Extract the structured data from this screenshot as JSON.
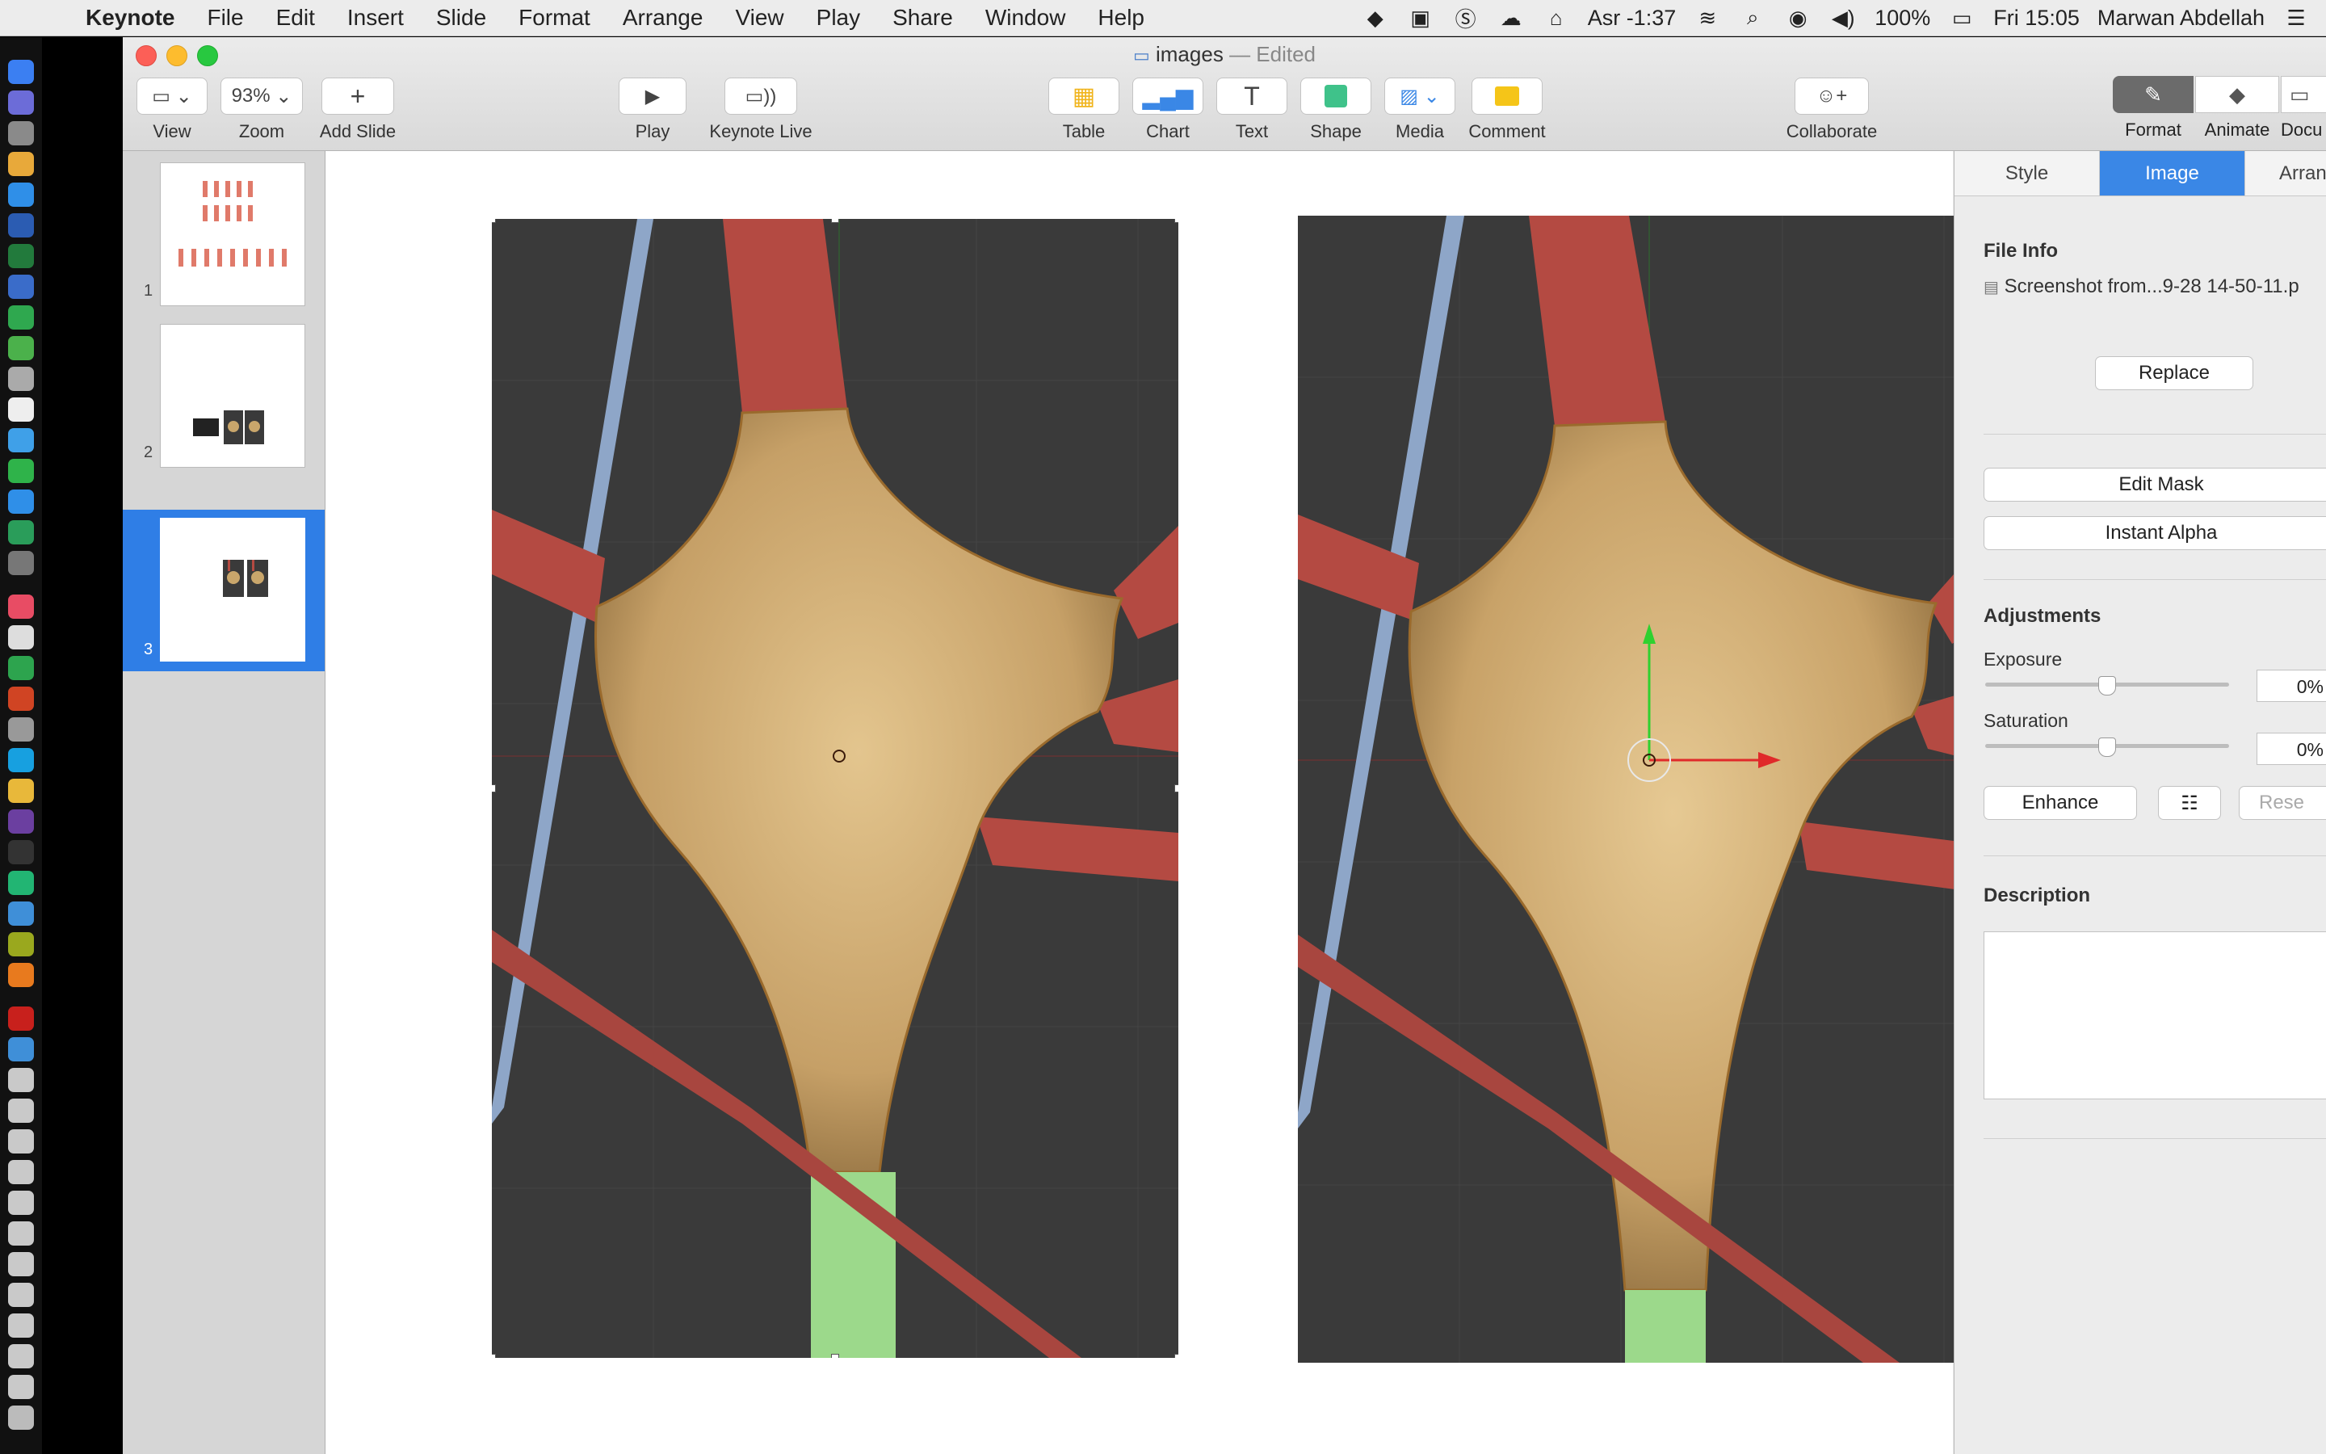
{
  "menubar": {
    "app_name": "Keynote",
    "items": [
      "File",
      "Edit",
      "Insert",
      "Slide",
      "Format",
      "Arrange",
      "View",
      "Play",
      "Share",
      "Window",
      "Help"
    ],
    "prayer_time": "Asr -1:37",
    "battery": "100%",
    "clock": "Fri 15:05",
    "user": "Marwan Abdellah"
  },
  "window": {
    "doc_title": "images",
    "doc_status": "— Edited"
  },
  "toolbar": {
    "view_label": "View",
    "zoom_value": "93%",
    "zoom_label": "Zoom",
    "add_slide_label": "Add Slide",
    "play_label": "Play",
    "keynote_live_label": "Keynote Live",
    "table_label": "Table",
    "chart_label": "Chart",
    "text_label": "Text",
    "shape_label": "Shape",
    "media_label": "Media",
    "comment_label": "Comment",
    "collaborate_label": "Collaborate",
    "format_label": "Format",
    "animate_label": "Animate",
    "document_label": "Docu"
  },
  "navigator": {
    "slides": [
      {
        "number": "1",
        "selected": false
      },
      {
        "number": "2",
        "selected": false
      },
      {
        "number": "3",
        "selected": true
      }
    ]
  },
  "inspector": {
    "tabs": [
      "Style",
      "Image",
      "Arran"
    ],
    "active_tab": "Image",
    "file_info_heading": "File Info",
    "file_name": "Screenshot from...9-28 14-50-11.p",
    "replace_label": "Replace",
    "edit_mask_label": "Edit Mask",
    "instant_alpha_label": "Instant Alpha",
    "adjustments_heading": "Adjustments",
    "exposure_label": "Exposure",
    "exposure_value": "0%",
    "saturation_label": "Saturation",
    "saturation_value": "0%",
    "enhance_label": "Enhance",
    "reset_label": "Rese",
    "description_heading": "Description"
  },
  "colors": {
    "accent": "#3a87e6",
    "soma": "#c9a66b",
    "dendrite": "#b44a42",
    "axon": "#9cd98b",
    "viewport_bg": "#3a3a3a"
  }
}
